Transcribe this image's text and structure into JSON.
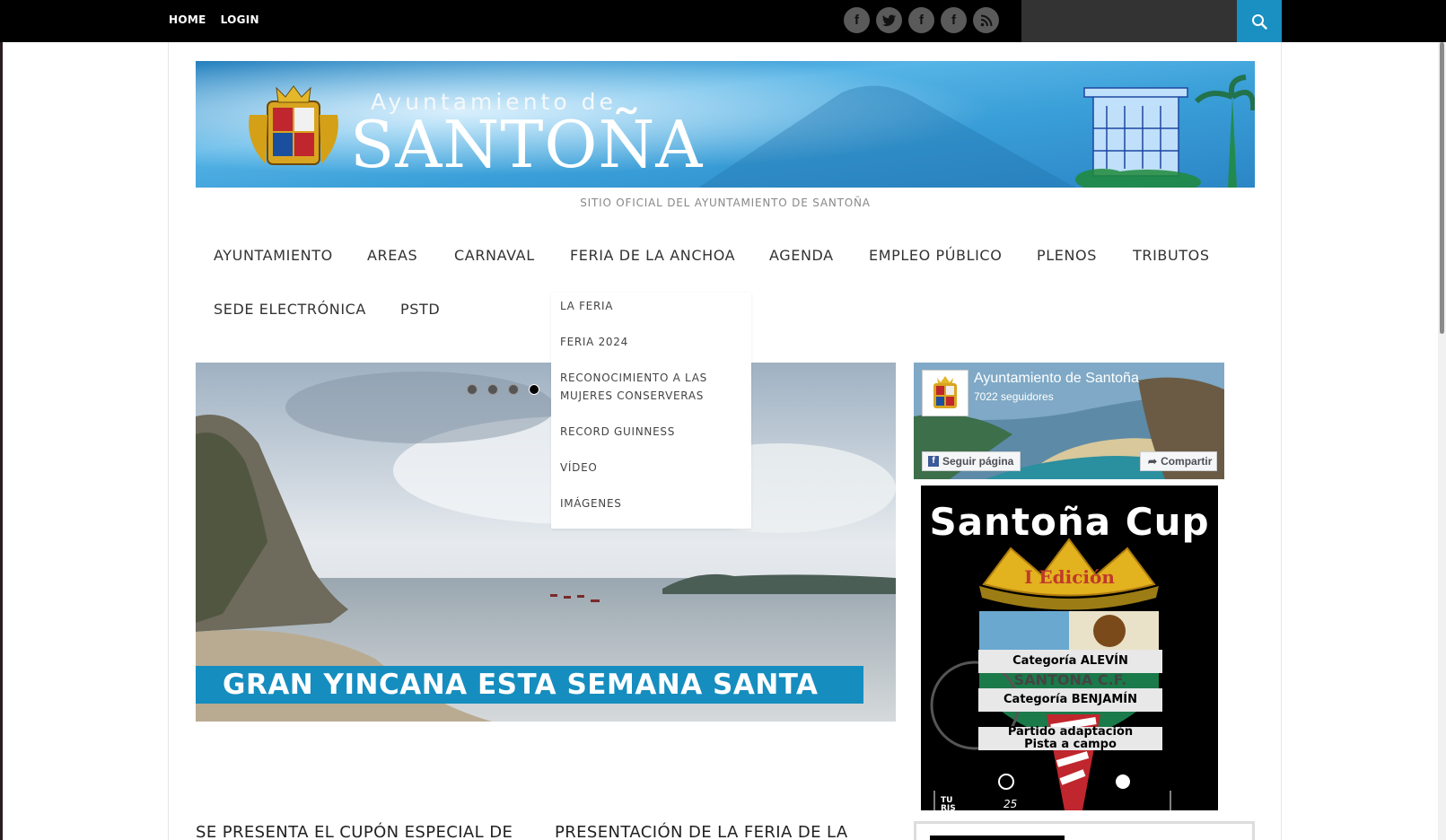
{
  "topbar": {
    "nav": [
      "HOME",
      "LOGIN"
    ],
    "socials": [
      {
        "icon": "facebook-icon",
        "glyph": "f"
      },
      {
        "icon": "twitter-icon",
        "glyph": "t"
      },
      {
        "icon": "facebook-icon",
        "glyph": "f"
      },
      {
        "icon": "facebook-icon",
        "glyph": "f"
      },
      {
        "icon": "rss-icon",
        "glyph": "rss"
      }
    ],
    "search_value": ""
  },
  "banner": {
    "line1": "Ayuntamiento de",
    "line2": "SANTOÑA"
  },
  "tagline": "SITIO OFICIAL DEL AYUNTAMIENTO DE SANTOÑA",
  "main_nav": [
    "AYUNTAMIENTO",
    "AREAS",
    "CARNAVAL",
    "FERIA DE LA ANCHOA",
    "AGENDA",
    "EMPLEO PÚBLICO",
    "PLENOS",
    "TRIBUTOS",
    "SEDE ELECTRÓNICA",
    "PSTD"
  ],
  "dropdown": {
    "items": [
      [
        "LA FERIA"
      ],
      [
        "FERIA 2024"
      ],
      [
        "RECONOCIMIENTO A LAS",
        "MUJERES CONSERVERAS"
      ],
      [
        "RECORD GUINNESS"
      ],
      [
        "VÍDEO"
      ],
      [
        "IMÁGENES"
      ]
    ]
  },
  "slider": {
    "caption": "GRAN YINCANA ESTA SEMANA SANTA",
    "dot_count": 4,
    "active_dot": 4
  },
  "facebook": {
    "page_name": "Ayuntamiento de Santoña",
    "followers": "7022 seguidores",
    "follow_label": "Seguir página",
    "share_label": "Compartir"
  },
  "cup_poster": {
    "title": "Santoña Cup",
    "edition": "I Edición",
    "club": "SANTOÑA C.F.",
    "tags": [
      "Categoría ALEVÍN",
      "Categoría BENJAMÍN",
      "Partido adaptación",
      "Pista a campo"
    ],
    "corner_text": [
      "TU",
      "RIS"
    ],
    "date": "25"
  },
  "posts": [
    {
      "title": "SE PRESENTA EL CUPÓN ESPECIAL DE"
    },
    {
      "title": "PRESENTACIÓN DE LA FERIA DE LA"
    }
  ],
  "colors": {
    "accent": "#168dbf",
    "topbar": "#000000"
  }
}
